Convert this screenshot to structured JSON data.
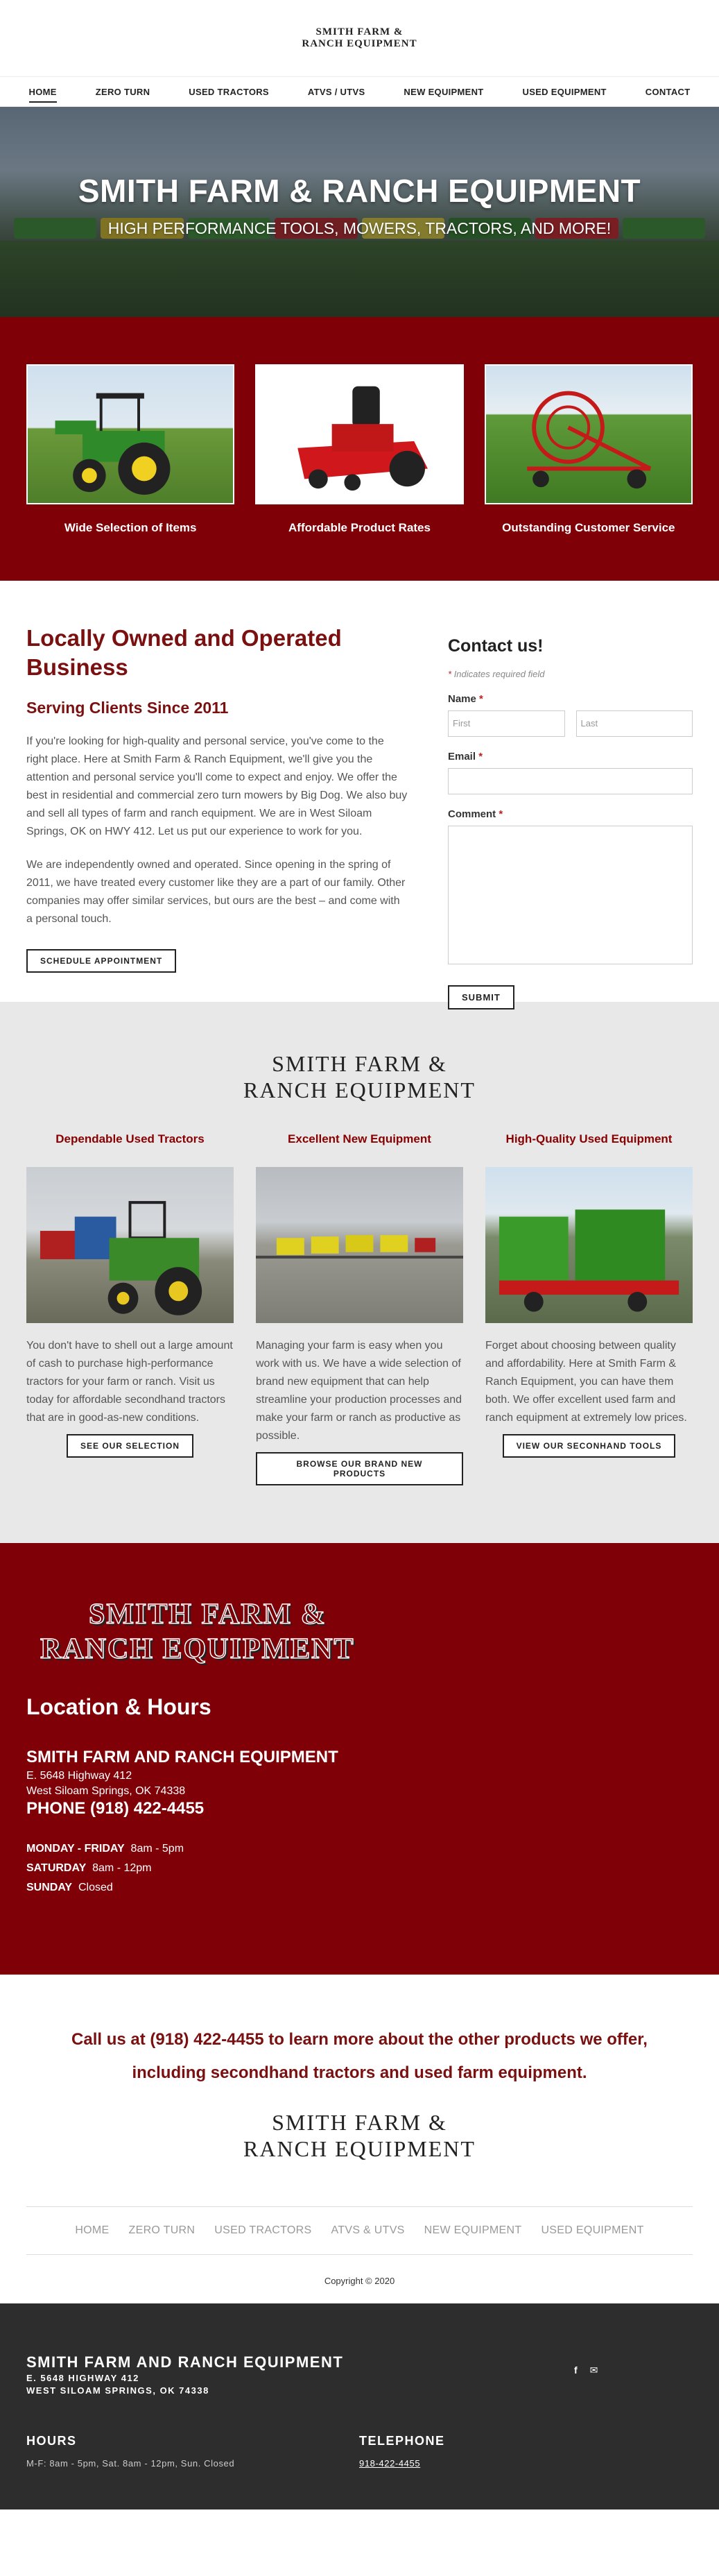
{
  "header": {
    "logo_line1": "SMITH FARM &",
    "logo_line2": "RANCH EQUIPMENT"
  },
  "nav": {
    "items": [
      "HOME",
      "ZERO TURN",
      "USED TRACTORS",
      "ATVS / UTVS",
      "NEW EQUIPMENT",
      "USED EQUIPMENT",
      "CONTACT"
    ],
    "active": "HOME"
  },
  "hero": {
    "title": "SMITH FARM & RANCH EQUIPMENT",
    "subtitle": "HIGH PERFORMANCE TOOLS, MOWERS, TRACTORS, AND MORE!"
  },
  "features": [
    {
      "label": "Wide Selection of Items",
      "image": "green-tractor"
    },
    {
      "label": "Affordable Product Rates",
      "image": "red-zero-turn-mower"
    },
    {
      "label": "Outstanding Customer Service",
      "image": "red-hay-rake"
    }
  ],
  "about": {
    "heading": "Locally Owned and Operated Business",
    "subheading": "Serving Clients Since 2011",
    "p1": "If you're looking for high-quality and personal service, you've come to the right place. Here at Smith Farm & Ranch Equipment, we'll give you the attention and personal service you'll come to expect and enjoy. We offer the best in residential and commercial zero turn mowers by Big Dog. We also buy and sell all types of farm and ranch equipment. We are in West Siloam Springs, OK on HWY 412. Let us put our experience to work for you.",
    "p2": "We are independently owned and operated. Since opening in the spring of 2011, we have treated every customer like they are a part of our family. Other companies may offer similar services, but ours are the best – and come with a personal touch.",
    "button": "SCHEDULE APPOINTMENT"
  },
  "contact": {
    "title": "Contact us!",
    "required_note": "Indicates required field",
    "name_label": "Name",
    "first_placeholder": "First",
    "last_placeholder": "Last",
    "email_label": "Email",
    "comment_label": "Comment",
    "submit": "SUBMIT"
  },
  "products": {
    "logo_line1": "SMITH FARM &",
    "logo_line2": "RANCH EQUIPMENT",
    "columns": [
      {
        "title": "Dependable Used Tractors",
        "text": "You don't have to shell out a large amount of cash to purchase high-performance tractors for your farm or ranch. Visit us today for affordable secondhand tractors that are in good-as-new conditions.",
        "button": "SEE OUR SELECTION"
      },
      {
        "title": "Excellent New Equipment",
        "text": "Managing your farm is easy when you work with us. We have a wide selection of brand new equipment that can help streamline your production processes and make your farm or ranch as productive as possible.",
        "button": "BROWSE OUR BRAND NEW PRODUCTS"
      },
      {
        "title": "High-Quality Used Equipment",
        "text": "Forget about choosing between quality and affordability. Here at Smith Farm & Ranch Equipment, you can have them both. We offer excellent used farm and ranch equipment at extremely low prices.",
        "button": "VIEW OUR SECONHAND TOOLS"
      }
    ]
  },
  "location": {
    "logo_line1": "SMITH FARM &",
    "logo_line2": "RANCH EQUIPMENT",
    "title": "Location & Hours",
    "business": "SMITH FARM AND RANCH EQUIPMENT",
    "address1": "E. 5648 Highway 412",
    "address2": "West Siloam Springs, OK 74338",
    "phone_label": "PHONE",
    "phone": "(918) 422-4455",
    "hours": [
      {
        "day": "MONDAY - FRIDAY",
        "time": "8am - 5pm"
      },
      {
        "day": "SATURDAY",
        "time": "8am - 12pm"
      },
      {
        "day": "SUNDAY",
        "time": "Closed"
      }
    ]
  },
  "call": {
    "line1": "Call us at (918) 422-4455 to learn more about the other products we offer,",
    "line2": "including secondhand tractors and used farm equipment.",
    "logo_line1": "SMITH FARM &",
    "logo_line2": "RANCH EQUIPMENT"
  },
  "footer_nav": {
    "items": [
      "HOME",
      "ZERO TURN",
      "USED TRACTORS",
      "ATVS & UTVS",
      "NEW EQUIPMENT",
      "USED EQUIPMENT"
    ],
    "copyright": "Copyright © 2020"
  },
  "footer": {
    "name": "SMITH FARM AND RANCH EQUIPMENT",
    "addr1": "E. 5648 HIGHWAY 412",
    "addr2": "WEST SILOAM SPRINGS, OK 74338",
    "hours_title": "HOURS",
    "hours_text": "M-F: 8am - 5pm, Sat. 8am - 12pm, Sun. Closed",
    "phone_title": "TELEPHONE",
    "phone": "918-422-4455",
    "social_icons": [
      "facebook-icon",
      "email-icon"
    ]
  }
}
